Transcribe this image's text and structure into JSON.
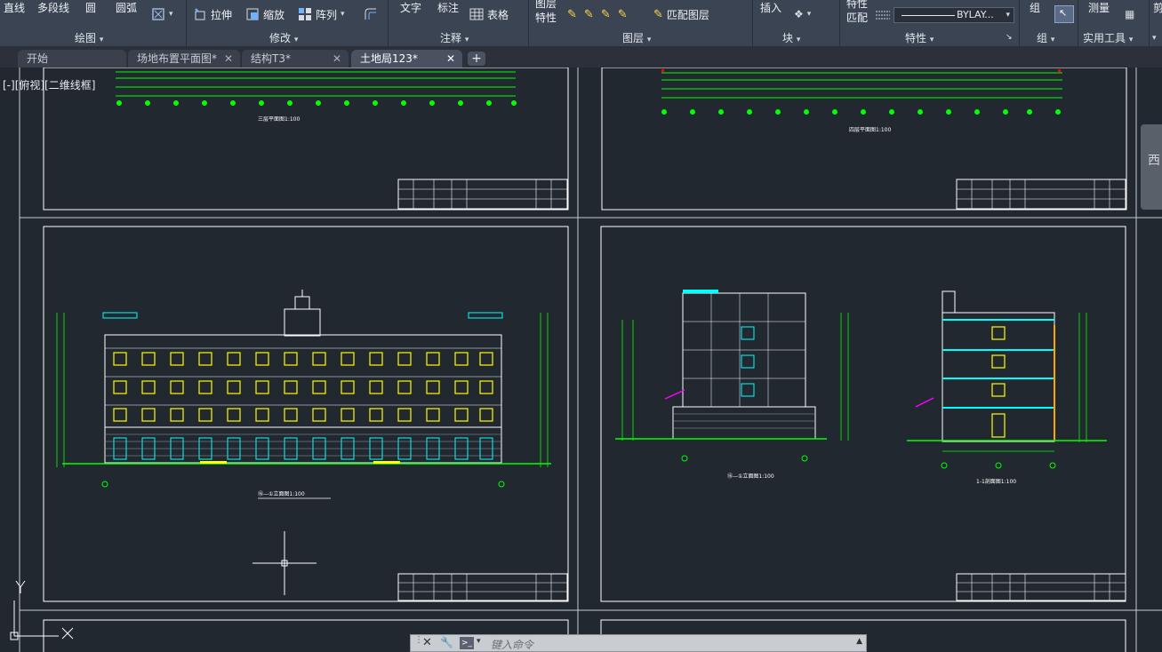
{
  "ribbon": {
    "draw": {
      "line": "直线",
      "polyline": "多段线",
      "circle": "圆",
      "arc": "圆弧",
      "panel": "绘图"
    },
    "modify": {
      "stretch": "拉伸",
      "scale": "缩放",
      "array": "阵列",
      "panel": "修改"
    },
    "annotation": {
      "text": "文字",
      "dimension": "标注",
      "table": "表格",
      "panel": "注释"
    },
    "layers": {
      "layer_properties_1": "图层",
      "layer_properties_2": "特性",
      "match_layer": "匹配图层",
      "panel": "图层"
    },
    "block": {
      "insert": "插入",
      "panel": "块"
    },
    "properties": {
      "match_1": "特性",
      "match_2": "匹配",
      "linetype_value": "BYLAY...",
      "panel": "特性"
    },
    "groups": {
      "group": "组",
      "panel": "组"
    },
    "utilities": {
      "measure": "测量",
      "panel": "实用工具"
    },
    "overflow": {
      "clipboard": "剪"
    }
  },
  "tabs": [
    {
      "label": "开始",
      "active": false
    },
    {
      "label": "场地布置平面图*",
      "active": false
    },
    {
      "label": "结构T3*",
      "active": false
    },
    {
      "label": "土地局123*",
      "active": true
    }
  ],
  "viewport": {
    "label": "[-][俯视][二维线框]"
  },
  "ucs": {
    "y": "Y",
    "x": "X"
  },
  "command_line": {
    "placeholder": "键入命令"
  },
  "sheets": {
    "top_left_title": "三层平面图1:100",
    "top_right_title": "四层平面图1:100",
    "mid_left_title": "⑯—①立面图1:100",
    "mid_right_title": "⑯—①立面图1:100",
    "section_title": "1-1剖面图1:100"
  },
  "colors": {
    "ribbon_bg": "#3b4453",
    "canvas_bg": "#212830",
    "cad_green": "#00ff00",
    "cad_cyan": "#00ffff",
    "cad_yellow": "#ffff00",
    "cad_white": "#ffffff",
    "cad_magenta": "#ff00ff"
  }
}
